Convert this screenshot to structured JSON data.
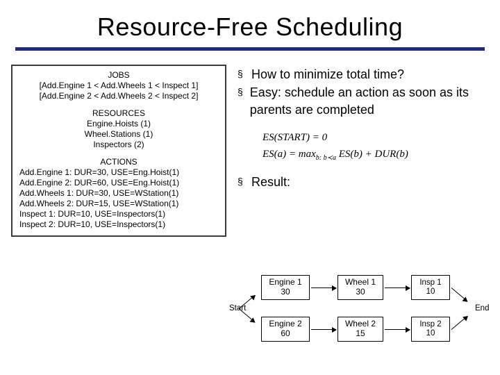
{
  "title": "Resource-Free Scheduling",
  "left": {
    "jobs": {
      "head": "JOBS",
      "lines": [
        "[Add.Engine 1 < Add.Wheels 1 < Inspect 1]",
        "[Add.Engine 2 < Add.Wheels 2 < Inspect 2]"
      ]
    },
    "resources": {
      "head": "RESOURCES",
      "lines": [
        "Engine.Hoists (1)",
        "Wheel.Stations (1)",
        "Inspectors (2)"
      ]
    },
    "actions": {
      "head": "ACTIONS",
      "lines": [
        "Add.Engine 1: DUR=30, USE=Eng.Hoist(1)",
        "Add.Engine 2: DUR=60, USE=Eng.Hoist(1)",
        "Add.Wheels 1: DUR=30, USE=WStation(1)",
        "Add.Wheels 2: DUR=15, USE=WStation(1)",
        "Inspect 1: DUR=10, USE=Inspectors(1)",
        "Inspect 2: DUR=10, USE=Inspectors(1)"
      ]
    }
  },
  "bullets": {
    "b1": "How to minimize total time?",
    "b2": "Easy: schedule an action as soon as its parents are completed",
    "b3": "Result:"
  },
  "formula": {
    "line1": "ES(START) = 0",
    "line2a": "ES(a) = max",
    "line2sub": "b: b≺a",
    "line2b": " ES(b) + DUR(b)"
  },
  "diagram": {
    "start": "Start",
    "end": "End",
    "n1a": "Engine 1",
    "n1b": "30",
    "n2a": "Engine 2",
    "n2b": "60",
    "n3a": "Wheel 1",
    "n3b": "30",
    "n4a": "Wheel 2",
    "n4b": "15",
    "n5a": "Insp 1",
    "n5b": "10",
    "n6a": "Insp 2",
    "n6b": "10"
  },
  "bullet_marker": "§"
}
